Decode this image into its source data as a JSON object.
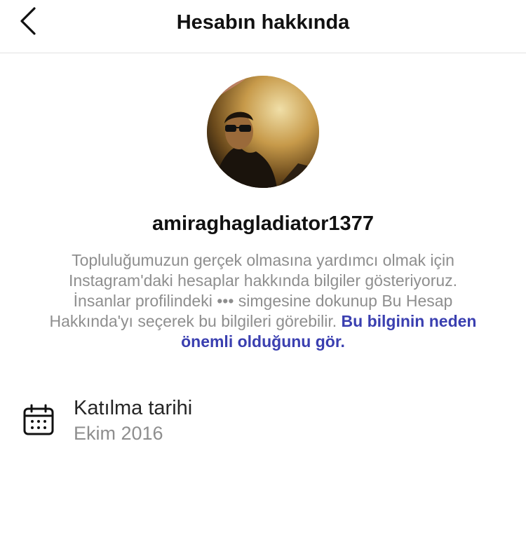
{
  "header": {
    "title": "Hesabın hakkında",
    "back_icon": "chevron-left-icon"
  },
  "profile": {
    "username": "amiraghagladiator1377",
    "avatar_icon": "profile-photo"
  },
  "description": {
    "text": "Topluluğumuzun gerçek olmasına yardımcı olmak için Instagram'daki hesaplar hakkında bilgiler gösteriyoruz. İnsanlar profilindeki ••• simgesine dokunup Bu Hesap Hakkında'yı seçerek bu bilgileri görebilir. ",
    "link_text": "Bu bilginin neden önemli olduğunu gör.",
    "link_color": "#3a3fb0"
  },
  "join_date": {
    "icon": "calendar-icon",
    "label": "Katılma tarihi",
    "value": "Ekim 2016"
  }
}
